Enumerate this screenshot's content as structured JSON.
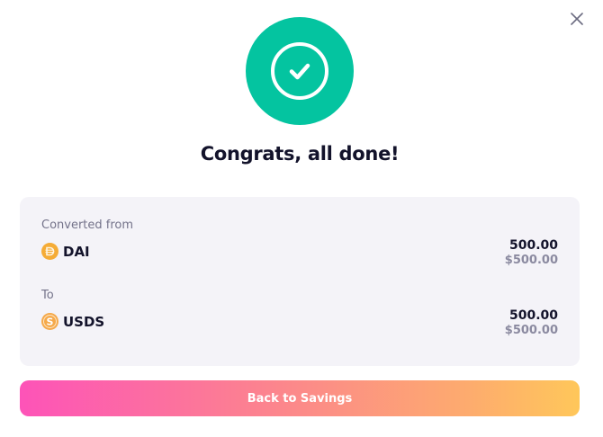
{
  "dialog": {
    "title": "Congrats, all done!",
    "close_icon": "close-icon",
    "success_icon": "check-circle-icon",
    "accent_color": "#04c4a0"
  },
  "summary": {
    "from": {
      "label": "Converted from",
      "token": "DAI",
      "token_icon": "dai-token-icon",
      "amount": "500.00",
      "amount_usd": "$500.00"
    },
    "to": {
      "label": "To",
      "token": "USDS",
      "token_icon": "usds-token-icon",
      "amount": "500.00",
      "amount_usd": "$500.00"
    }
  },
  "actions": {
    "back_label": "Back to Savings"
  }
}
